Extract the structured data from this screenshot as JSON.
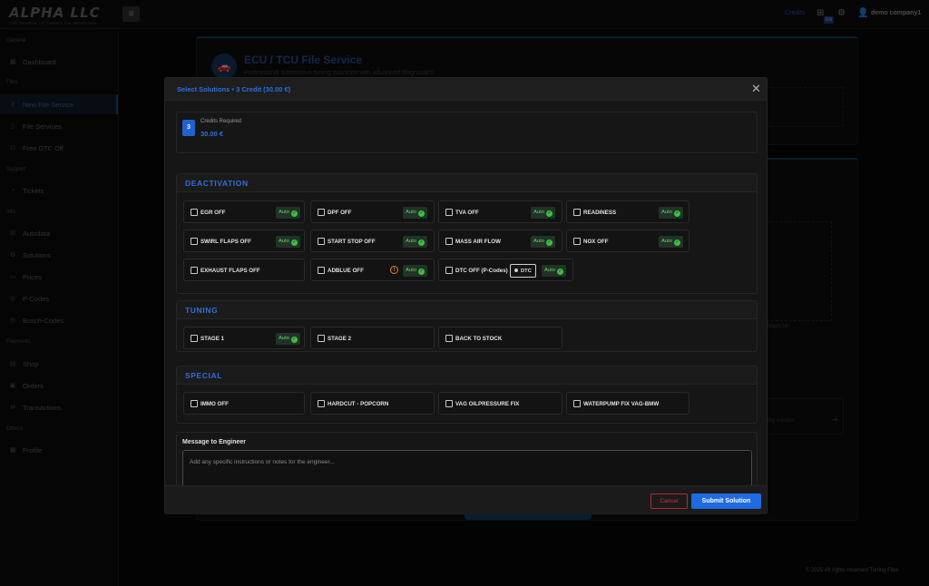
{
  "topbar": {
    "logo_text": "ALPHA LLC",
    "logo_sub": "THE SOURCE OF TUNING CALIBRATIONS",
    "credits_link": "Credits",
    "lang_badge": "EN",
    "user_name": "demo company1"
  },
  "sidebar": {
    "groups": {
      "general": "General",
      "files": "Files",
      "support": "Support",
      "info": "Info",
      "payments": "Payments",
      "others": "Others"
    },
    "items": [
      {
        "label": "Dashboard",
        "icon": "grid-icon"
      },
      {
        "label": "New File Service",
        "icon": "upload-icon",
        "active": true
      },
      {
        "label": "File Services",
        "icon": "file-icon"
      },
      {
        "label": "Free DTC Off",
        "icon": "gift-icon"
      },
      {
        "label": "Tickets",
        "icon": "ticket-icon"
      },
      {
        "label": "Autodata",
        "icon": "car-icon"
      },
      {
        "label": "Solutions",
        "icon": "gear-icon"
      },
      {
        "label": "Prices",
        "icon": "tag-icon"
      },
      {
        "label": "P-Codes",
        "icon": "code-icon"
      },
      {
        "label": "Bosch-Codes",
        "icon": "chip-icon"
      },
      {
        "label": "Shop",
        "icon": "cart-icon"
      },
      {
        "label": "Orders",
        "icon": "bag-icon"
      },
      {
        "label": "Transactions",
        "icon": "transfer-icon"
      },
      {
        "label": "Profile",
        "icon": "user-icon"
      }
    ]
  },
  "background": {
    "title": "ECU / TCU File Service",
    "subtitle": "Professional automotive tuning solutions with advanced diagnostics",
    "file_fragment": "maps.bin",
    "box_text": "ing solution"
  },
  "footer": "© 2025 All rights reserved Tuning Files",
  "modal": {
    "title": "Select Solutions • 3 Credit (30.00 €)",
    "close_glyph": "✕",
    "credits": {
      "count": "3",
      "label": "Credits Required",
      "value": "30.00 €"
    },
    "auto_label": "Auto",
    "dtc_label": "DTC",
    "sections": {
      "deactivation": {
        "title": "DEACTIVATION",
        "options": [
          "EGR OFF",
          "DPF OFF",
          "TVA OFF",
          "READINESS",
          "SWIRL FLAPS OFF",
          "START STOP OFF",
          "MASS AIR FLOW",
          "NOX OFF",
          "EXHAUST FLAPS OFF",
          "ADBLUE OFF",
          "DTC OFF (P-Codes)"
        ]
      },
      "tuning": {
        "title": "TUNING",
        "options": [
          "STAGE 1",
          "STAGE 2",
          "BACK TO STOCK"
        ]
      },
      "special": {
        "title": "SPECIAL",
        "options": [
          "IMMO OFF",
          "HARDCUT - POPCORN",
          "VAG OILPRESSURE FIX",
          "WATERPUMP FIX VAG-BMW"
        ]
      }
    },
    "message": {
      "label": "Message to Engineer",
      "placeholder": "Add any specific instructions or notes for the engineer...",
      "value": ""
    },
    "buttons": {
      "cancel": "Cancel",
      "submit": "Submit Solution"
    }
  },
  "colors": {
    "accent": "#2f6fdc",
    "auto_green": "#3fbf3f",
    "cancel_red": "#c83434",
    "warning": "#e08a1e"
  }
}
